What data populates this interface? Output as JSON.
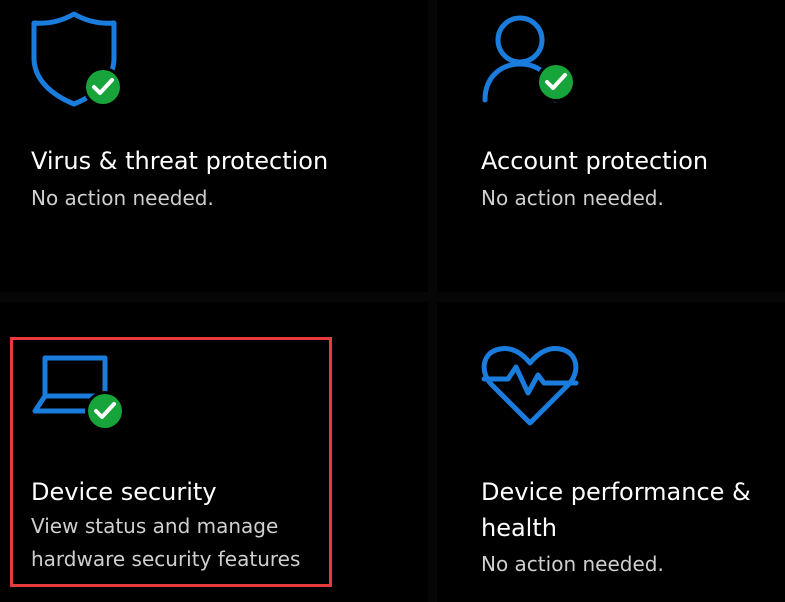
{
  "colors": {
    "background": "#000000",
    "icon_blue": "#1a7cdd",
    "check_green": "#17a53b",
    "highlight_red": "#e8393c",
    "title_text": "#ffffff",
    "subtitle_text": "#cfcfcf"
  },
  "tiles": {
    "virus": {
      "icon": "shield-icon",
      "badge": "checkmark-icon",
      "title": "Virus & threat protection",
      "status": "No action needed."
    },
    "account": {
      "icon": "person-icon",
      "badge": "checkmark-icon",
      "title": "Account protection",
      "status": "No action needed."
    },
    "device": {
      "icon": "laptop-icon",
      "badge": "checkmark-icon",
      "title": "Device security",
      "status_line1": "View status and manage",
      "status_line2": "hardware security features"
    },
    "performance": {
      "icon": "heart-pulse-icon",
      "title_line1": "Device performance &",
      "title_line2": "health",
      "status": "No action needed."
    }
  }
}
